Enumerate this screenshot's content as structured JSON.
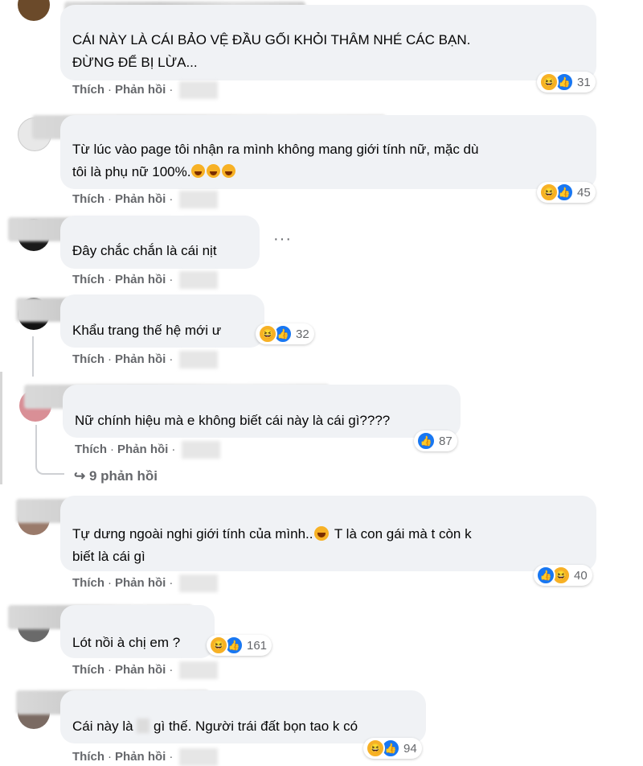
{
  "actions": {
    "like": "Thích",
    "reply": "Phản hồi",
    "sep": "·"
  },
  "comments": [
    {
      "text": "CÁI NÀY LÀ CÁI BẢO VỆ ĐẦU GỐI KHỎI THÂM NHÉ CÁC BẠN.\nĐỪNG ĐỂ BỊ LỪA...",
      "reactions": [
        "haha",
        "like"
      ],
      "count": "31"
    },
    {
      "text": "Từ lúc vào page tôi nhận ra mình không mang giới tính nữ, mặc dù\ntôi là phụ nữ 100%.",
      "reactions": [
        "haha",
        "like"
      ],
      "count": "45"
    },
    {
      "text": "Đây chắc chắn là cái nịt"
    },
    {
      "text": "Khẩu trang thế hệ mới ư",
      "reactions": [
        "haha",
        "like"
      ],
      "count": "32"
    },
    {
      "text": "Nữ chính hiệu mà e không biết cái này là cái gì????",
      "reactions": [
        "like"
      ],
      "count": "87"
    },
    {
      "text_a": "Tự dưng ngoài nghi giới tính của mình..",
      "text_b": " T là con gái mà t còn k",
      "text_c": "biết là cái gì",
      "reactions": [
        "like",
        "haha"
      ],
      "count": "40"
    },
    {
      "text": "Lót nồi à chị em ?",
      "reactions": [
        "haha",
        "like"
      ],
      "count": "161"
    },
    {
      "text_a": "Cái này là ",
      "text_b": " gì thế. Người trái đất bọn tao k có",
      "reactions": [
        "haha",
        "like"
      ],
      "count": "94"
    }
  ],
  "replies_link": "9 phản hồi",
  "reply_arrow": "↪",
  "icons": {
    "like": "like-icon",
    "haha": "haha-icon",
    "more": "more-dots-icon"
  }
}
